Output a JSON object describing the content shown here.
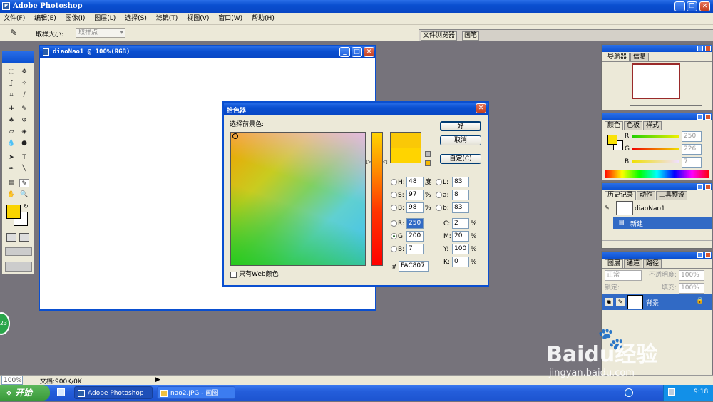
{
  "app": {
    "title": "Adobe Photoshop"
  },
  "menu": [
    "文件(F)",
    "编辑(E)",
    "图像(I)",
    "图层(L)",
    "选择(S)",
    "滤镜(T)",
    "视图(V)",
    "窗口(W)",
    "帮助(H)"
  ],
  "options": {
    "sample_size_label": "取样大小:",
    "sample_size_value": "取样点"
  },
  "palette_well": [
    "文件浏览器",
    "画笔"
  ],
  "document": {
    "title": "diaoNao1 @ 100%(RGB)"
  },
  "picker": {
    "title": "拾色器",
    "prompt": "选择前景色:",
    "ok": "好",
    "cancel": "取消",
    "custom": "自定(C)",
    "web_only": "只有Web颜色",
    "fields": {
      "H": "48",
      "S": "97",
      "B": "98",
      "R": "250",
      "G": "200",
      "Bb": "7",
      "L": "83",
      "a": "8",
      "b": "83",
      "C": "2",
      "M": "20",
      "Y": "100",
      "K": "0"
    },
    "labels": {
      "H": "H:",
      "S": "S:",
      "B": "B:",
      "R": "R:",
      "G": "G:",
      "Bb": "B:",
      "L": "L:",
      "a": "a:",
      "b": "b:",
      "C": "C:",
      "M": "M:",
      "Y": "Y:",
      "K": "K:"
    },
    "units": {
      "deg": "度",
      "pct": "%"
    },
    "hash": "#",
    "hex": "FAC807",
    "new_color": "#fac807",
    "old_color": "#ffd400"
  },
  "navigator": {
    "tabs": [
      "导航器",
      "信息"
    ]
  },
  "color_panel": {
    "tabs": [
      "颜色",
      "色板",
      "样式"
    ],
    "r_label": "R",
    "g_label": "G",
    "b_label": "B",
    "r": "250",
    "g": "226",
    "b": "7",
    "foreground": "#fae207"
  },
  "history": {
    "tabs": [
      "历史记录",
      "动作",
      "工具预设"
    ],
    "snapshot": "diaoNao1",
    "state": "新建"
  },
  "layers": {
    "tabs": [
      "图层",
      "通道",
      "路径"
    ],
    "mode": "正常",
    "opacity_label": "不透明度:",
    "opacity": "100%",
    "lock_label": "锁定:",
    "fill_label": "填充:",
    "fill": "100%",
    "layer_name": "背景"
  },
  "status": {
    "zoom": "100%",
    "doc": "文档:900K/0K"
  },
  "taskbar": {
    "start": "开始",
    "tasks": [
      "Adobe Photoshop",
      "nao2.JPG - 画图"
    ],
    "time": "9:18"
  },
  "badge": "23",
  "watermark": {
    "brand": "Baidu经验",
    "url": "jingyan.baidu.com"
  },
  "toolbox": {
    "foreground": "#fad400",
    "background": "#ffffff"
  }
}
